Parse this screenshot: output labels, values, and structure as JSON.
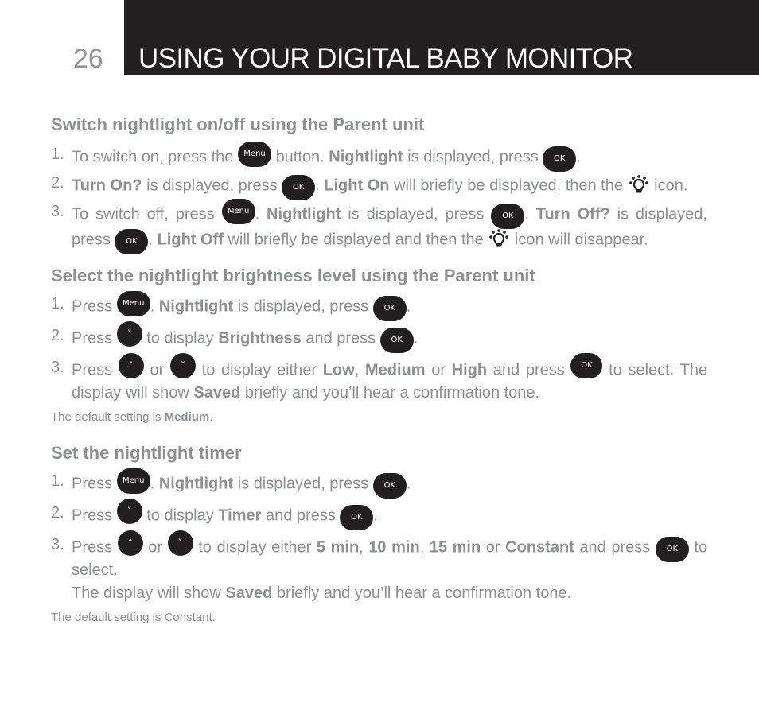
{
  "header": {
    "page_number": "26",
    "title": "USING YOUR DIGITAL BABY MONITOR"
  },
  "keys": {
    "menu": "Menu",
    "ok": "OK",
    "up": "^",
    "down": "v"
  },
  "icons": {
    "menu_button": "menu-button-icon",
    "ok_button": "ok-button-icon",
    "up_button": "up-arrow-button-icon",
    "down_button": "down-arrow-button-icon",
    "nightlight": "nightlight-bulb-icon"
  },
  "colors": {
    "header_bg": "#231f20",
    "text": "#8e8f92",
    "key_bg": "#231f20"
  },
  "sections": [
    {
      "heading": "Switch nightlight on/off using the Parent unit",
      "steps": [
        {
          "num": "1.",
          "t1": "To switch on, press the",
          "t2": "button.",
          "b1": "Nightlight",
          "t3": "is displayed, press",
          "t4": "."
        },
        {
          "num": "2.",
          "b1": "Turn On?",
          "t1": "is displayed, press",
          "t2": ".",
          "b2": "Light On",
          "t3": "will briefly be displayed, then the",
          "t4": "icon."
        },
        {
          "num": "3.",
          "t1": "To switch off, press",
          "t2": ".",
          "b1": "Nightlight",
          "t3": "is displayed, press",
          "t4": ".",
          "b2": "Turn Off?",
          "t5": "is displayed, press",
          "t6": ".",
          "b3": "Light Off",
          "t7": "will briefly be displayed and then the",
          "t8": "icon will disappear."
        }
      ]
    },
    {
      "heading": "Select the nightlight brightness level using the Parent unit",
      "steps": [
        {
          "num": "1.",
          "t1": "Press",
          "t2": ".",
          "b1": "Nightlight",
          "t3": "is displayed, press",
          "t4": "."
        },
        {
          "num": "2.",
          "t1": "Press",
          "t2": "to display",
          "b1": "Brightness",
          "t3": "and press",
          "t4": "."
        },
        {
          "num": "3.",
          "t1": "Press",
          "t2": "or",
          "t3": "to display either",
          "b1": "Low",
          "t4": ",",
          "b2": "Medium",
          "t5": "or",
          "b3": "High",
          "t6": "and press",
          "t7": "to select. The display will show",
          "b4": "Saved",
          "t8": "briefly and you’ll hear a confirmation tone."
        }
      ],
      "note": {
        "text": "The default setting is",
        "bold": "Medium",
        "end": "."
      }
    },
    {
      "heading": "Set the nightlight timer",
      "steps": [
        {
          "num": "1.",
          "t1": "Press",
          "t2": ".",
          "b1": "Nightlight",
          "t3": "is displayed, press",
          "t4": "."
        },
        {
          "num": "2.",
          "t1": "Press",
          "t2": "to display",
          "b1": "Timer",
          "t3": "and press",
          "t4": "."
        },
        {
          "num": "3.",
          "t1": "Press",
          "t2": "or",
          "t3": "to display either",
          "b1": "5 min",
          "t4": ",",
          "b2": "10 min",
          "t5": ",",
          "b3": "15 min",
          "t6": "or",
          "b4": "Constant",
          "t7": "and press",
          "t8": "to select.",
          "t9": "The display will show",
          "b5": "Saved",
          "t10": "briefly and you’ll hear a confirmation tone."
        }
      ],
      "note": {
        "text": "The default setting is Constant."
      }
    }
  ]
}
